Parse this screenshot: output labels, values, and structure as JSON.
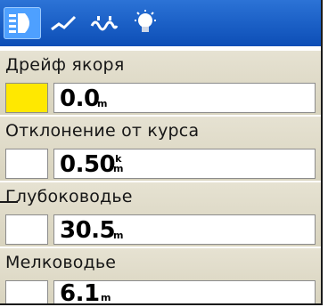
{
  "colors": {
    "tab_bar": "#1d62c8",
    "tab_active": "#4ea0ff",
    "section_bg": "#dcd8c4",
    "alarm_on": "#ffe800",
    "alarm_off": "#ffffff"
  },
  "tabs": [
    {
      "icon": "lighthouse-icon",
      "active": true
    },
    {
      "icon": "track-line-icon",
      "active": false
    },
    {
      "icon": "waves-icon",
      "active": false
    },
    {
      "icon": "lightbulb-icon",
      "active": false
    }
  ],
  "alarms": [
    {
      "label": "Дрейф якоря",
      "value": "0.0",
      "unit": "m",
      "unit_top": "",
      "enabled": true
    },
    {
      "label": "Отклонение от курса",
      "value": "0.50",
      "unit": "m",
      "unit_top": "k",
      "enabled": false
    },
    {
      "label": "Глубоководье",
      "value": "30.5",
      "unit": "m",
      "unit_top": "",
      "enabled": false
    },
    {
      "label": "Мелководье",
      "value": "6.1",
      "unit": "m",
      "unit_top": "",
      "enabled": false
    }
  ]
}
